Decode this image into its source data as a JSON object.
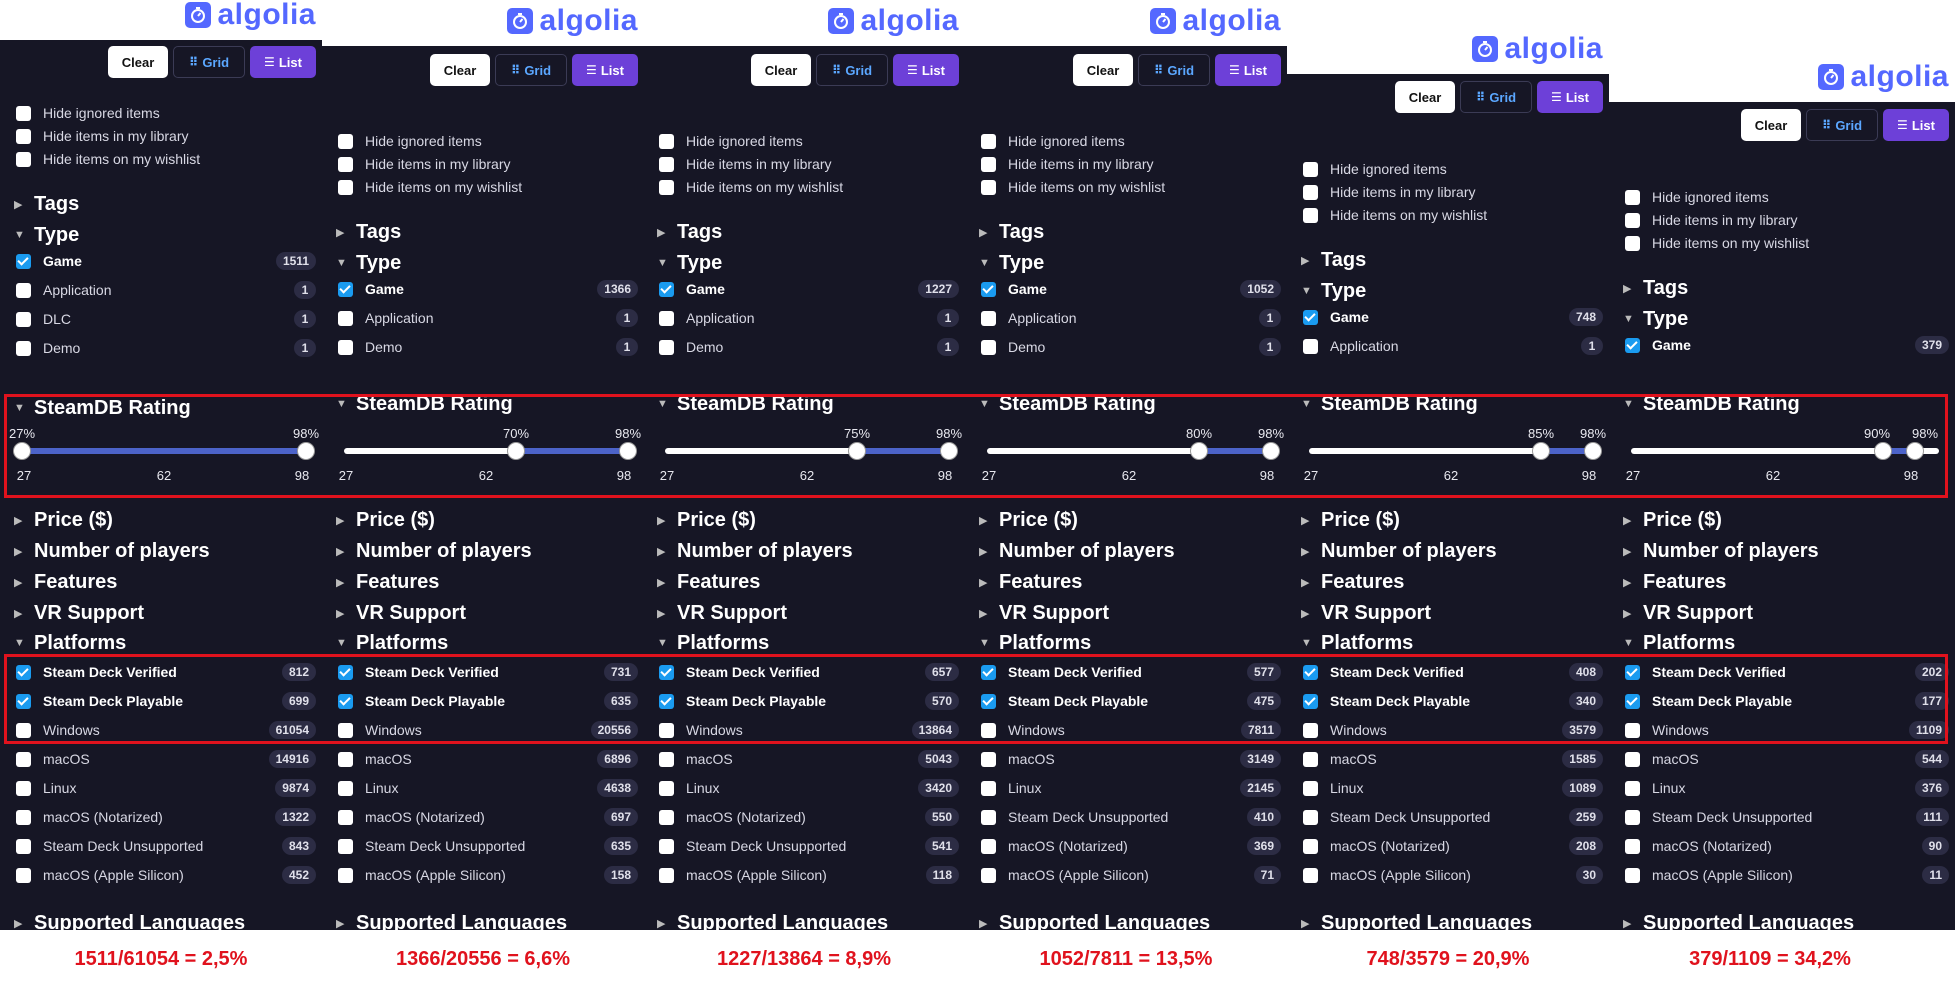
{
  "logo_text": "algolia",
  "buttons": {
    "clear": "Clear",
    "grid": "Grid",
    "list": "List"
  },
  "filters": [
    "Hide ignored items",
    "Hide items in my library",
    "Hide items on my wishlist"
  ],
  "headings": {
    "tags": "Tags",
    "type": "Type",
    "rating": "SteamDB Rating",
    "price": "Price ($)",
    "players": "Number of players",
    "features": "Features",
    "vr": "VR Support",
    "platforms": "Platforms",
    "languages": "Supported Languages"
  },
  "slider_ticks": [
    "27",
    "62",
    "98"
  ],
  "colors": {
    "panel_bg": "#161625",
    "accent_logo": "#5468ff",
    "list_button": "#6d40d8",
    "highlight_red": "#e0121d",
    "checkbox_checked": "#1a9bf0"
  },
  "panels": [
    {
      "type_items": [
        {
          "label": "Game",
          "count": "1511",
          "checked": true
        },
        {
          "label": "Application",
          "count": "1",
          "checked": false
        },
        {
          "label": "DLC",
          "count": "1",
          "checked": false
        },
        {
          "label": "Demo",
          "count": "1",
          "checked": false
        }
      ],
      "rating": {
        "min_label": "27%",
        "max_label": "98%",
        "min": 27,
        "max": 98
      },
      "platforms": [
        {
          "label": "Steam Deck Verified",
          "count": "812",
          "checked": true
        },
        {
          "label": "Steam Deck Playable",
          "count": "699",
          "checked": true
        },
        {
          "label": "Windows",
          "count": "61054",
          "checked": false
        },
        {
          "label": "macOS",
          "count": "14916",
          "checked": false
        },
        {
          "label": "Linux",
          "count": "9874",
          "checked": false
        },
        {
          "label": "macOS (Notarized)",
          "count": "1322",
          "checked": false
        },
        {
          "label": "Steam Deck Unsupported",
          "count": "843",
          "checked": false
        },
        {
          "label": "macOS (Apple Silicon)",
          "count": "452",
          "checked": false
        }
      ],
      "ratio": "1511/61054 = 2,5%"
    },
    {
      "type_items": [
        {
          "label": "Game",
          "count": "1366",
          "checked": true
        },
        {
          "label": "Application",
          "count": "1",
          "checked": false
        },
        {
          "label": "Demo",
          "count": "1",
          "checked": false
        }
      ],
      "rating": {
        "min_label": "70%",
        "max_label": "98%",
        "min": 70,
        "max": 98
      },
      "platforms": [
        {
          "label": "Steam Deck Verified",
          "count": "731",
          "checked": true
        },
        {
          "label": "Steam Deck Playable",
          "count": "635",
          "checked": true
        },
        {
          "label": "Windows",
          "count": "20556",
          "checked": false
        },
        {
          "label": "macOS",
          "count": "6896",
          "checked": false
        },
        {
          "label": "Linux",
          "count": "4638",
          "checked": false
        },
        {
          "label": "macOS (Notarized)",
          "count": "697",
          "checked": false
        },
        {
          "label": "Steam Deck Unsupported",
          "count": "635",
          "checked": false
        },
        {
          "label": "macOS (Apple Silicon)",
          "count": "158",
          "checked": false
        }
      ],
      "ratio": "1366/20556 = 6,6%"
    },
    {
      "type_items": [
        {
          "label": "Game",
          "count": "1227",
          "checked": true
        },
        {
          "label": "Application",
          "count": "1",
          "checked": false
        },
        {
          "label": "Demo",
          "count": "1",
          "checked": false
        }
      ],
      "rating": {
        "min_label": "75%",
        "max_label": "98%",
        "min": 75,
        "max": 98
      },
      "platforms": [
        {
          "label": "Steam Deck Verified",
          "count": "657",
          "checked": true
        },
        {
          "label": "Steam Deck Playable",
          "count": "570",
          "checked": true
        },
        {
          "label": "Windows",
          "count": "13864",
          "checked": false
        },
        {
          "label": "macOS",
          "count": "5043",
          "checked": false
        },
        {
          "label": "Linux",
          "count": "3420",
          "checked": false
        },
        {
          "label": "macOS (Notarized)",
          "count": "550",
          "checked": false
        },
        {
          "label": "Steam Deck Unsupported",
          "count": "541",
          "checked": false
        },
        {
          "label": "macOS (Apple Silicon)",
          "count": "118",
          "checked": false
        }
      ],
      "ratio": "1227/13864 = 8,9%"
    },
    {
      "type_items": [
        {
          "label": "Game",
          "count": "1052",
          "checked": true
        },
        {
          "label": "Application",
          "count": "1",
          "checked": false
        },
        {
          "label": "Demo",
          "count": "1",
          "checked": false
        }
      ],
      "rating": {
        "min_label": "80%",
        "max_label": "98%",
        "min": 80,
        "max": 98
      },
      "platforms": [
        {
          "label": "Steam Deck Verified",
          "count": "577",
          "checked": true
        },
        {
          "label": "Steam Deck Playable",
          "count": "475",
          "checked": true
        },
        {
          "label": "Windows",
          "count": "7811",
          "checked": false
        },
        {
          "label": "macOS",
          "count": "3149",
          "checked": false
        },
        {
          "label": "Linux",
          "count": "2145",
          "checked": false
        },
        {
          "label": "Steam Deck Unsupported",
          "count": "410",
          "checked": false
        },
        {
          "label": "macOS (Notarized)",
          "count": "369",
          "checked": false
        },
        {
          "label": "macOS (Apple Silicon)",
          "count": "71",
          "checked": false
        }
      ],
      "ratio": "1052/7811 = 13,5%"
    },
    {
      "type_items": [
        {
          "label": "Game",
          "count": "748",
          "checked": true
        },
        {
          "label": "Application",
          "count": "1",
          "checked": false
        }
      ],
      "rating": {
        "min_label": "85%",
        "max_label": "98%",
        "min": 85,
        "max": 98
      },
      "platforms": [
        {
          "label": "Steam Deck Verified",
          "count": "408",
          "checked": true
        },
        {
          "label": "Steam Deck Playable",
          "count": "340",
          "checked": true
        },
        {
          "label": "Windows",
          "count": "3579",
          "checked": false
        },
        {
          "label": "macOS",
          "count": "1585",
          "checked": false
        },
        {
          "label": "Linux",
          "count": "1089",
          "checked": false
        },
        {
          "label": "Steam Deck Unsupported",
          "count": "259",
          "checked": false
        },
        {
          "label": "macOS (Notarized)",
          "count": "208",
          "checked": false
        },
        {
          "label": "macOS (Apple Silicon)",
          "count": "30",
          "checked": false
        }
      ],
      "ratio": "748/3579 = 20,9%"
    },
    {
      "type_items": [
        {
          "label": "Game",
          "count": "379",
          "checked": true
        }
      ],
      "rating": {
        "min_label": "90%",
        "max_label": "98%",
        "min": 90,
        "max": 98
      },
      "platforms": [
        {
          "label": "Steam Deck Verified",
          "count": "202",
          "checked": true
        },
        {
          "label": "Steam Deck Playable",
          "count": "177",
          "checked": true
        },
        {
          "label": "Windows",
          "count": "1109",
          "checked": false
        },
        {
          "label": "macOS",
          "count": "544",
          "checked": false
        },
        {
          "label": "Linux",
          "count": "376",
          "checked": false
        },
        {
          "label": "Steam Deck Unsupported",
          "count": "111",
          "checked": false
        },
        {
          "label": "macOS (Notarized)",
          "count": "90",
          "checked": false
        },
        {
          "label": "macOS (Apple Silicon)",
          "count": "11",
          "checked": false
        }
      ],
      "ratio": "379/1109 = 34,2%"
    }
  ]
}
